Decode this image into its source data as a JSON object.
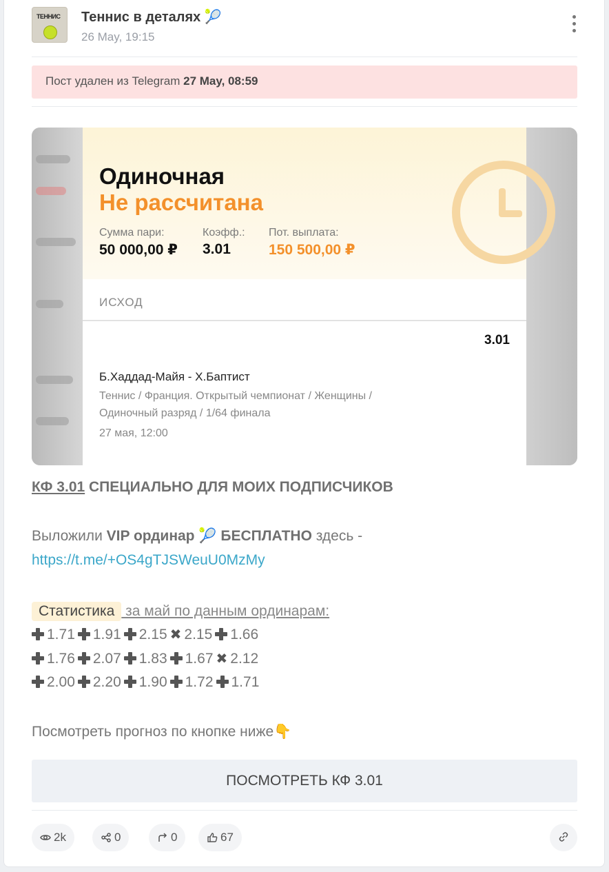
{
  "channel": {
    "title": "Теннис в деталях",
    "title_emoji": "🎾",
    "date": "26 May, 19:15",
    "avatar_text": "ТЕННИС"
  },
  "notice": {
    "text": "Пост удален из Telegram ",
    "date": "27 May, 08:59"
  },
  "ticket": {
    "type": "Одиночная",
    "status": "Не рассчитана",
    "stake_label": "Сумма пари:",
    "stake_value": "50 000,00 ₽",
    "odds_label": "Коэфф.:",
    "odds_value": "3.01",
    "payout_label": "Пот. выплата:",
    "payout_value": "150 500,00 ₽",
    "outcome_label": "ИСХОД",
    "outcome_odds": "3.01",
    "match": "Б.Хаддад-Майя - Х.Баптист",
    "event": "Теннис / Франция. Открытый чемпионат / Женщины / Одиночный разряд / 1/64 финала",
    "time": "27 мая, 12:00"
  },
  "post": {
    "kf": "КФ 3.01",
    "kf_rest": " СПЕЦИАЛЬНО ДЛЯ МОИХ ПОДПИСЧИКОВ",
    "vip_pre": "Выложили ",
    "vip_bold": "VIP ординар",
    "vip_emoji": "🎾",
    "vip_free": "БЕСПЛАТНО",
    "vip_post": " здесь -",
    "link": "https://t.me/+OS4gTJSWeuU0MzMy",
    "stat_badge": "Статистика",
    "stat_rest": " за май по данным ординарам:",
    "rows": [
      [
        {
          "w": true,
          "v": "1.71"
        },
        {
          "w": true,
          "v": "1.91"
        },
        {
          "w": true,
          "v": "2.15"
        },
        {
          "w": false,
          "v": "2.15"
        },
        {
          "w": true,
          "v": "1.66"
        }
      ],
      [
        {
          "w": true,
          "v": "1.76"
        },
        {
          "w": true,
          "v": "2.07"
        },
        {
          "w": true,
          "v": "1.83"
        },
        {
          "w": true,
          "v": "1.67"
        },
        {
          "w": false,
          "v": "2.12"
        }
      ],
      [
        {
          "w": true,
          "v": "2.00"
        },
        {
          "w": true,
          "v": "2.20"
        },
        {
          "w": true,
          "v": "1.90"
        },
        {
          "w": true,
          "v": "1.72"
        },
        {
          "w": true,
          "v": "1.71"
        }
      ]
    ],
    "see_text": "Посмотреть прогноз по кнопке ниже",
    "see_emoji": "👇",
    "button": "ПОСМОТРЕТЬ КФ 3.01"
  },
  "stats": {
    "views": "2k",
    "shares": "0",
    "forwards": "0",
    "likes": "67"
  },
  "colors": {
    "accent_orange": "#f3902b",
    "link_blue": "#3ba7c9",
    "notice_bg": "#fde1e1"
  }
}
